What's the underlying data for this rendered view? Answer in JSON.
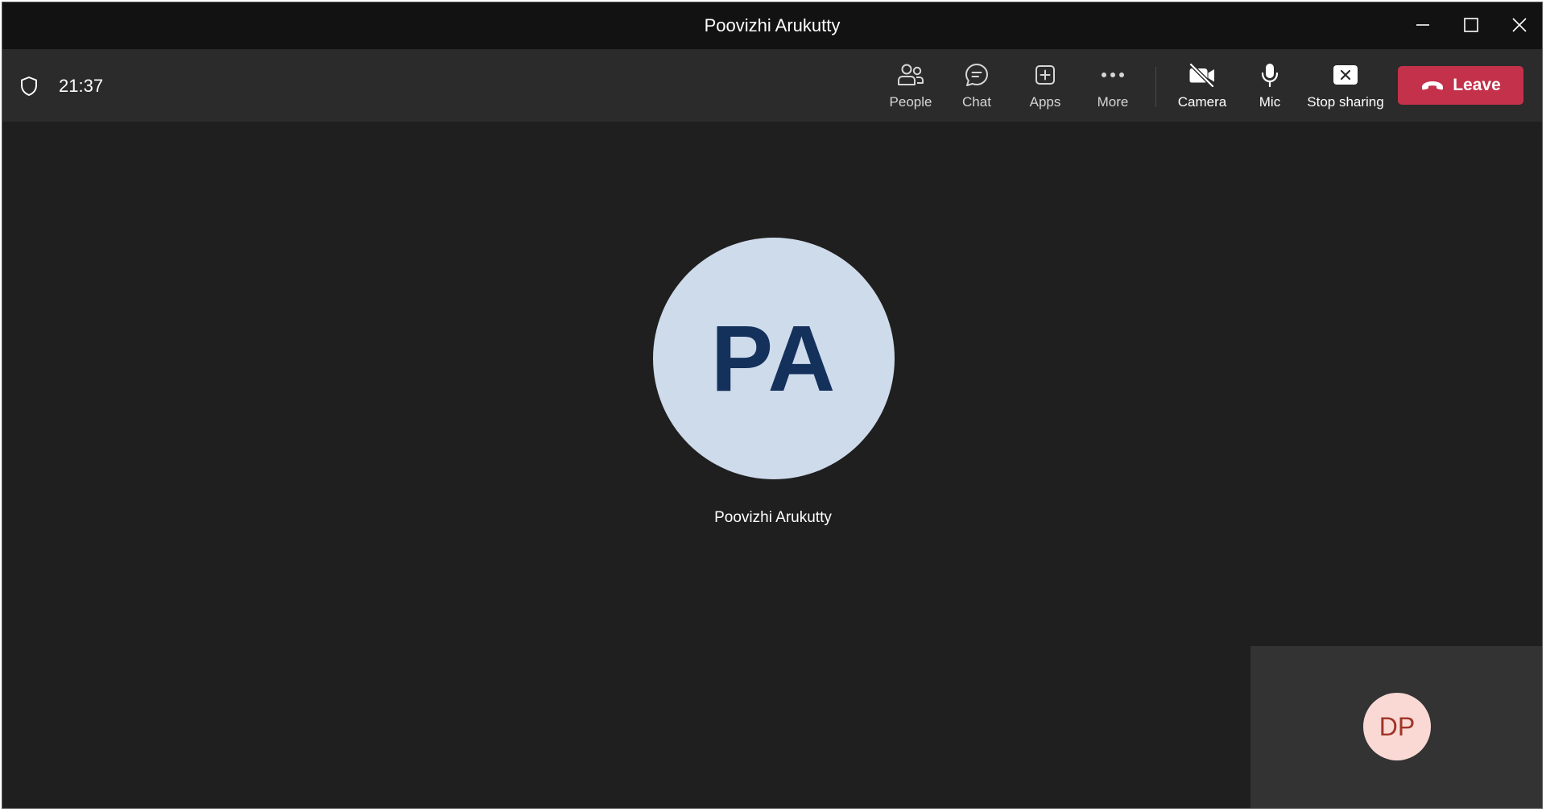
{
  "window": {
    "title": "Poovizhi Arukutty"
  },
  "toolbar": {
    "timer": "21:37",
    "buttons": [
      {
        "label": "People",
        "icon": "people-icon"
      },
      {
        "label": "Chat",
        "icon": "chat-icon"
      },
      {
        "label": "Apps",
        "icon": "apps-icon"
      },
      {
        "label": "More",
        "icon": "more-icon"
      },
      {
        "label": "Camera",
        "icon": "camera-off-icon"
      },
      {
        "label": "Mic",
        "icon": "mic-icon"
      },
      {
        "label": "Stop sharing",
        "icon": "stop-sharing-icon"
      }
    ],
    "leave_label": "Leave"
  },
  "stage": {
    "main_participant": {
      "initials": "PA",
      "name": "Poovizhi Arukutty"
    },
    "self_view": {
      "initials": "DP"
    }
  },
  "colors": {
    "leave": "#c4314b",
    "main_avatar_bg": "#cedbeb",
    "main_avatar_text": "#14315c",
    "self_avatar_bg": "#fad9d5",
    "self_avatar_text": "#a03428"
  }
}
